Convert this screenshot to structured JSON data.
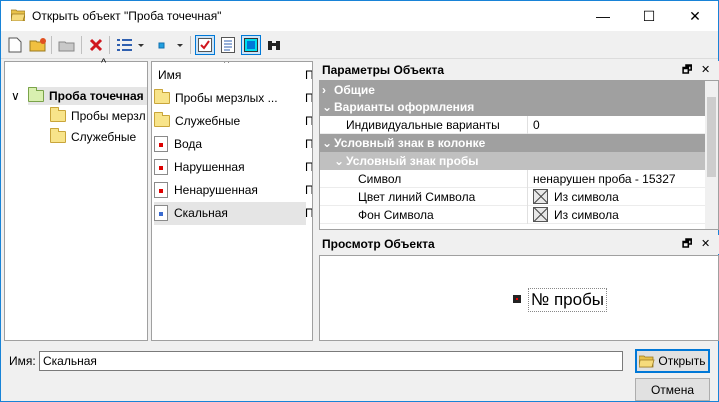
{
  "window": {
    "title": "Открыть объект \"Проба точечная\"",
    "minimize": "—",
    "maximize": "☐",
    "close": "✕"
  },
  "tree": {
    "expander": "∨",
    "root": "Проба точечная",
    "children": [
      "Пробы мерзл",
      "Служебные"
    ]
  },
  "list": {
    "column": "Имя",
    "cut_column": "П",
    "items": [
      {
        "name": "Пробы мерзлых ...",
        "icon": "folder-icon"
      },
      {
        "name": "Служебные",
        "icon": "folder-icon"
      },
      {
        "name": "Вода",
        "icon": "symbol-icon"
      },
      {
        "name": "Нарушенная",
        "icon": "symbol-icon"
      },
      {
        "name": "Ненарушенная",
        "icon": "symbol-icon"
      },
      {
        "name": "Скальная",
        "icon": "symbol-blue-icon"
      }
    ],
    "selected": "Скальная"
  },
  "props": {
    "title": "Параметры Объекта",
    "pin": "🗗",
    "close": "✕",
    "rows": {
      "general": "Общие",
      "variants": "Варианты оформления",
      "individual_k": "Индивидуальные варианты",
      "individual_v": "0",
      "column_sign": "Условный знак в колонке",
      "sample_sign": "Условный знак пробы",
      "symbol_k": "Символ",
      "symbol_v": "ненарушен проба - 15327",
      "linecolor_k": "Цвет линий Символа",
      "linecolor_v": "Из символа",
      "bg_k": "Фон Символа",
      "bg_v": "Из символа"
    }
  },
  "preview": {
    "title": "Просмотр Объекта",
    "pin": "🗗",
    "close": "✕",
    "label": "№ пробы"
  },
  "footer": {
    "name_label": "Имя:",
    "name_value": "Скальная",
    "open_button": "Открыть",
    "cancel_button": "Отмена"
  },
  "colors": {
    "accent": "#0078d7",
    "category_bg": "#a0a0a0",
    "subcategory_bg": "#c0c0c0"
  }
}
